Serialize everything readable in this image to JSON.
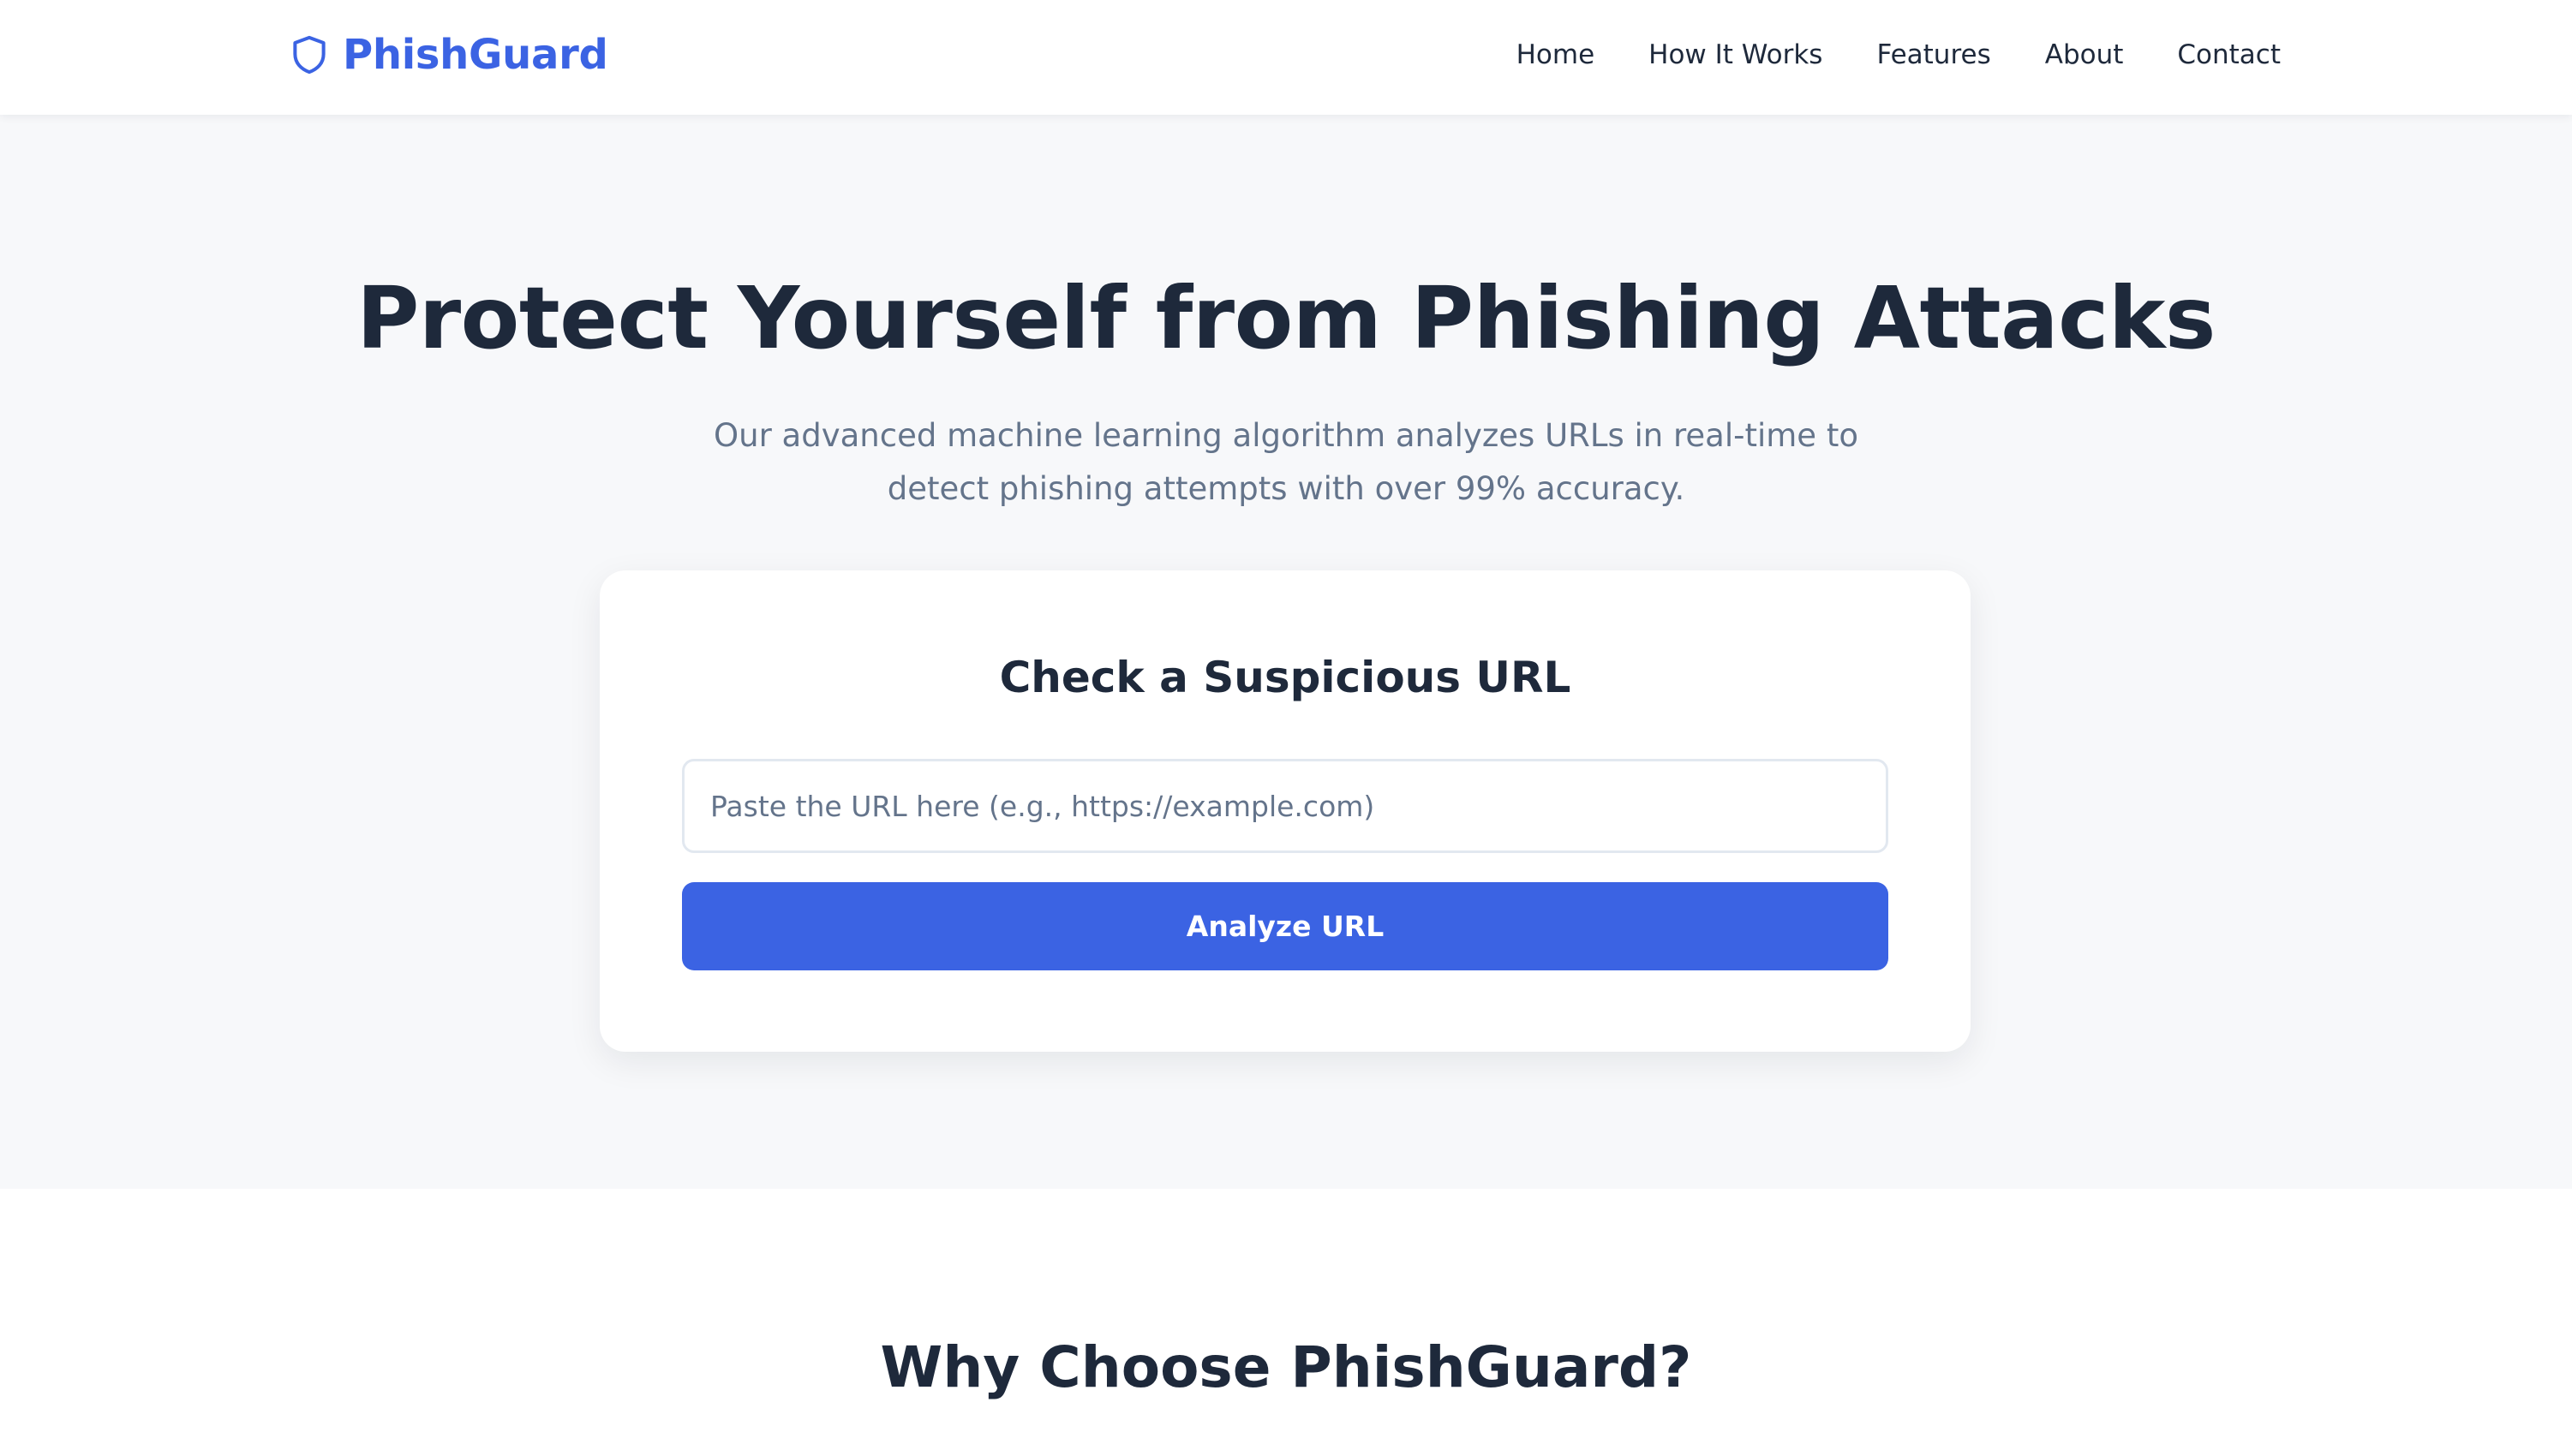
{
  "colors": {
    "accent": "#3b63e3",
    "text_dark": "#1e293b",
    "text_muted": "#64748b",
    "hero_bg": "#f7f8fa"
  },
  "nav": {
    "brand": "PhishGuard",
    "brand_icon": "shield-icon",
    "links": [
      "Home",
      "How It Works",
      "Features",
      "About",
      "Contact"
    ]
  },
  "hero": {
    "title": "Protect Yourself from Phishing Attacks",
    "subtitle": "Our advanced machine learning algorithm analyzes URLs in real-time to detect phishing attempts with over 99% accuracy."
  },
  "url_checker": {
    "title": "Check a Suspicious URL",
    "input_value": "",
    "input_placeholder": "Paste the URL here (e.g., https://example.com)",
    "button_label": "Analyze URL"
  },
  "features": {
    "title": "Why Choose PhishGuard?"
  }
}
